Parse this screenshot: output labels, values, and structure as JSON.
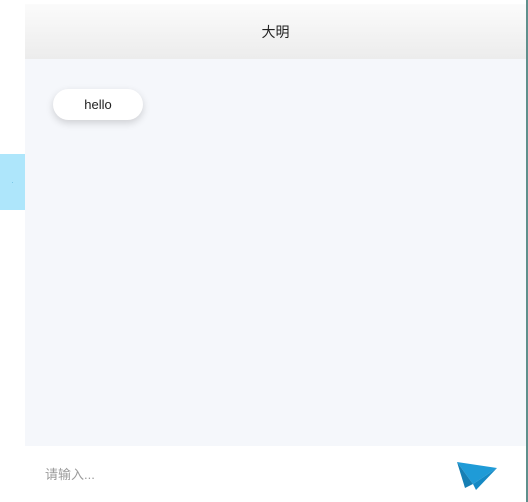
{
  "header": {
    "title": "大明"
  },
  "messages": [
    {
      "text": "hello"
    }
  ],
  "composer": {
    "placeholder": "请输入...",
    "send_icon": "paper-plane-icon"
  },
  "colors": {
    "accent": "#1f9bd7",
    "chat_background": "#f5f7fb",
    "side_tab": "#aee6fb",
    "window_border": "#5f8f8c"
  }
}
